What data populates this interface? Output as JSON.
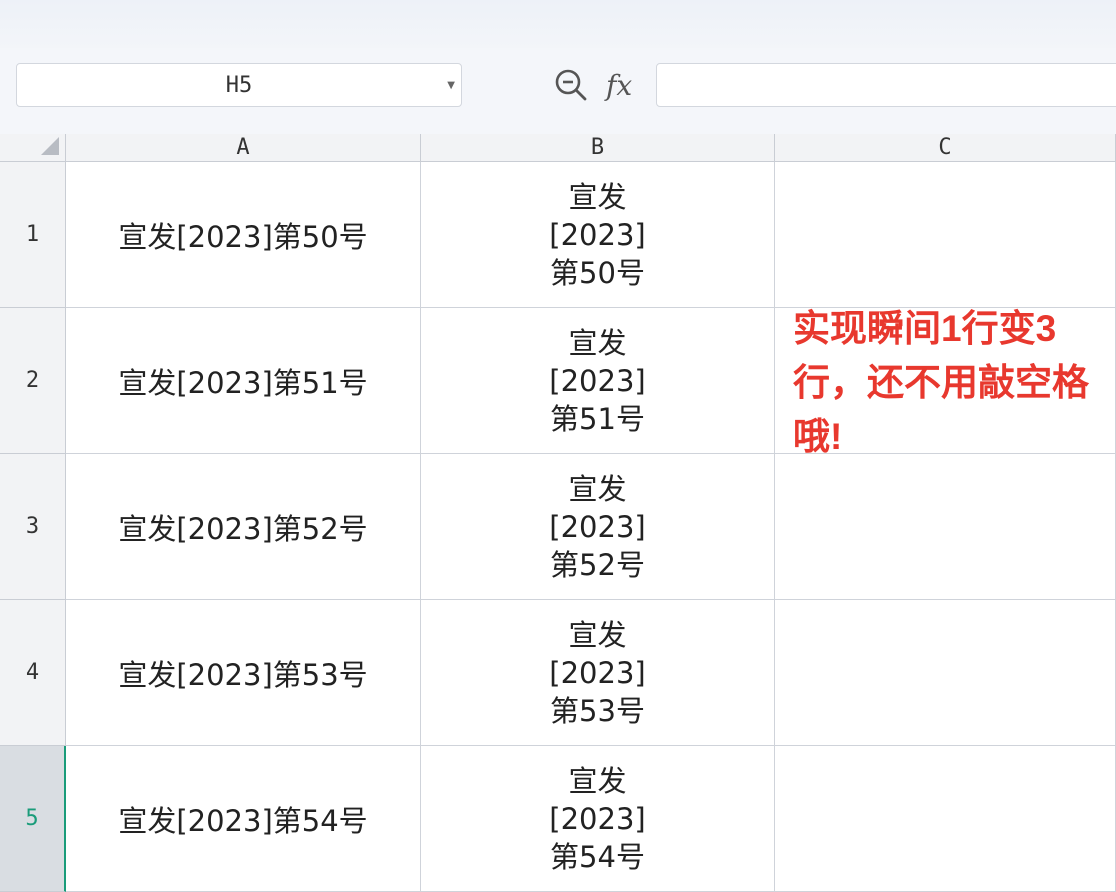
{
  "formula_bar": {
    "name_box": "H5",
    "fx_label": "fx",
    "formula_value": ""
  },
  "columns": [
    "A",
    "B",
    "C"
  ],
  "rows": [
    {
      "num": "1",
      "a": "宣发[2023]第50号",
      "b": [
        "宣发",
        "[2023]",
        "第50号"
      ]
    },
    {
      "num": "2",
      "a": "宣发[2023]第51号",
      "b": [
        "宣发",
        "[2023]",
        "第51号"
      ]
    },
    {
      "num": "3",
      "a": "宣发[2023]第52号",
      "b": [
        "宣发",
        "[2023]",
        "第52号"
      ]
    },
    {
      "num": "4",
      "a": "宣发[2023]第53号",
      "b": [
        "宣发",
        "[2023]",
        "第53号"
      ]
    },
    {
      "num": "5",
      "a": "宣发[2023]第54号",
      "b": [
        "宣发",
        "[2023]",
        "第54号"
      ]
    }
  ],
  "active_row": "5",
  "annotation": "实现瞬间1行变3行，还不用敲空格哦!",
  "colors": {
    "annotation": "#e8382e",
    "active_accent": "#1a9c7a"
  },
  "icons": [
    "zoom-out-icon",
    "fx-icon",
    "dropdown-caret-icon",
    "select-all-icon"
  ]
}
